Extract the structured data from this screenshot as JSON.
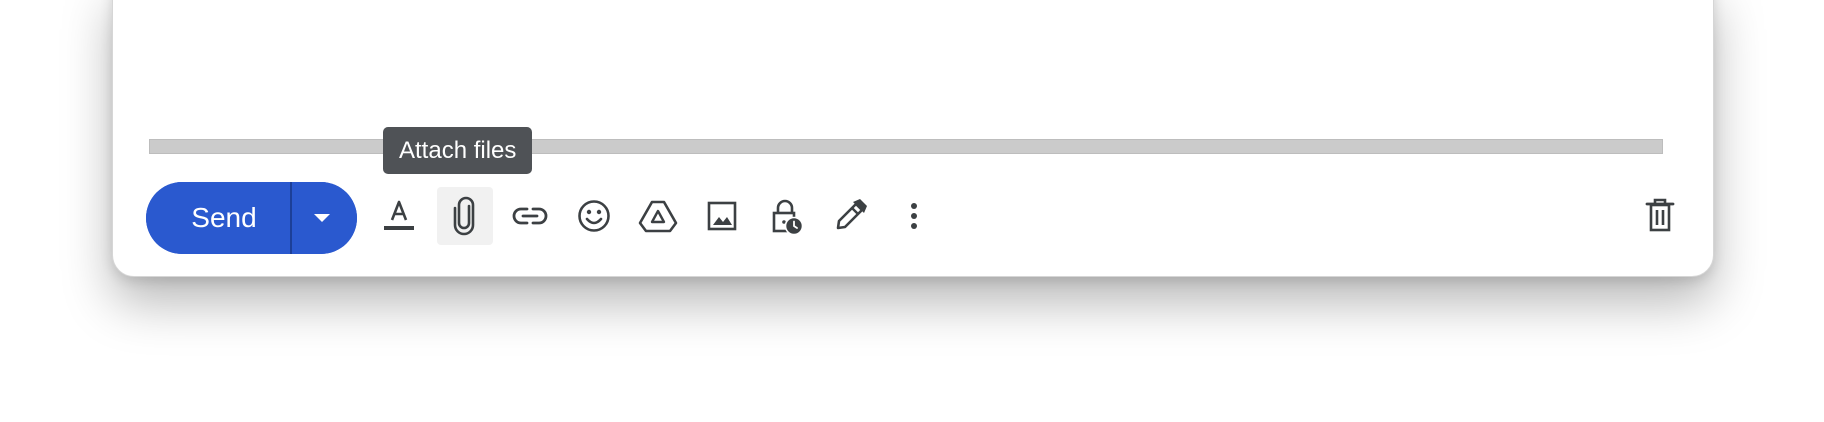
{
  "compose_toolbar": {
    "send_label": "Send",
    "tooltip_text": "Attach files",
    "accent_color": "#2a59cf",
    "icons": [
      "formatting-options-icon",
      "attach-files-icon",
      "insert-link-icon",
      "insert-emoji-icon",
      "insert-drive-icon",
      "insert-photo-icon",
      "confidential-mode-icon",
      "insert-signature-icon",
      "more-options-icon",
      "discard-draft-icon"
    ]
  }
}
